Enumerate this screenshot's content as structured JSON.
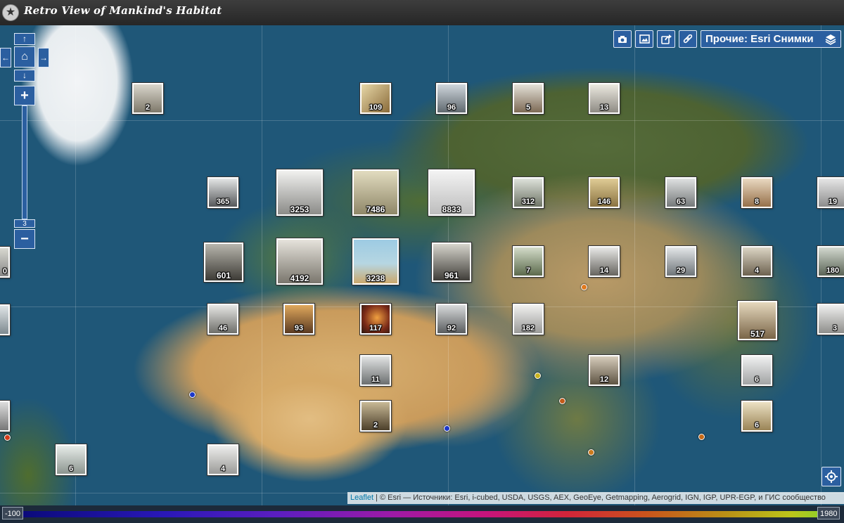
{
  "title_bar": {
    "title": "Retro View of Mankind's Habitat",
    "logo_icon": "star-icon"
  },
  "toolbar": {
    "camera_icon": "camera-icon",
    "image_icon": "image-icon",
    "share_icon": "share-icon",
    "link_icon": "link-icon",
    "layer_label": "Прочие: Esri Снимки",
    "layer_icon": "layers-icon"
  },
  "zoom": {
    "level": "3",
    "plus": "+",
    "minus": "−"
  },
  "pan": {
    "up": "↑",
    "down": "↓",
    "left": "←",
    "right": "→",
    "home_icon": "home-icon"
  },
  "markers": [
    {
      "count": "2"
    },
    {
      "count": "109"
    },
    {
      "count": "96"
    },
    {
      "count": "5"
    },
    {
      "count": "13"
    },
    {
      "count": "365"
    },
    {
      "count": "3253"
    },
    {
      "count": "7486"
    },
    {
      "count": "8833"
    },
    {
      "count": "312"
    },
    {
      "count": "146"
    },
    {
      "count": "63"
    },
    {
      "count": "8"
    },
    {
      "count": "19"
    },
    {
      "count": "0"
    },
    {
      "count": "601"
    },
    {
      "count": "4192"
    },
    {
      "count": "3238"
    },
    {
      "count": "961"
    },
    {
      "count": "7"
    },
    {
      "count": "14"
    },
    {
      "count": "29"
    },
    {
      "count": "4"
    },
    {
      "count": "180"
    },
    {
      "count": "46"
    },
    {
      "count": "93"
    },
    {
      "count": "117"
    },
    {
      "count": "92"
    },
    {
      "count": "182"
    },
    {
      "count": "517"
    },
    {
      "count": "3"
    },
    {
      "count": "11"
    },
    {
      "count": "12"
    },
    {
      "count": "6"
    },
    {
      "count": "2"
    },
    {
      "count": "6"
    },
    {
      "count": "6"
    },
    {
      "count": "4"
    }
  ],
  "point_colors": [
    "#e07a1f",
    "#d23c1a",
    "#1c37c8",
    "#1c37c8",
    "#c9b21d",
    "#c35a19",
    "#cc7a1c",
    "#c86a17"
  ],
  "attribution": {
    "leaflet": "Leaflet",
    "text": " | © Esri — Источники: Esri, i-cubed, USDA, USGS, AEX, GeoEye, Getmapping, Aerogrid, IGN, IGP, UPR-EGP, и ГИС сообщество"
  },
  "timeline": {
    "start": "-100",
    "end": "1980"
  },
  "locate_icon": "locate-icon"
}
